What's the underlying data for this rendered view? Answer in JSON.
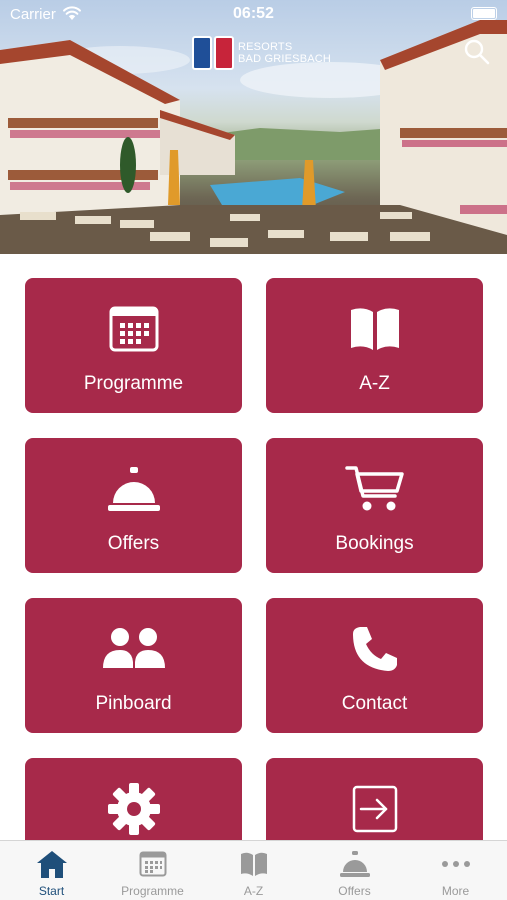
{
  "status_bar": {
    "carrier": "Carrier",
    "time": "06:52"
  },
  "header": {
    "brand_line1": "RESORTS",
    "brand_line2": "BAD GRIESBACH",
    "logo_colors": [
      "#1f4f98",
      "#c7243a"
    ]
  },
  "tiles": [
    {
      "label": "Programme",
      "icon": "calendar-icon"
    },
    {
      "label": "A-Z",
      "icon": "book-icon"
    },
    {
      "label": "Offers",
      "icon": "service-bell-icon"
    },
    {
      "label": "Bookings",
      "icon": "shopping-cart-icon"
    },
    {
      "label": "Pinboard",
      "icon": "users-icon"
    },
    {
      "label": "Contact",
      "icon": "phone-icon"
    },
    {
      "label": "",
      "icon": "gear-icon"
    },
    {
      "label": "",
      "icon": "sign-in-icon"
    }
  ],
  "tabbar": {
    "items": [
      {
        "label": "Start",
        "icon": "home-icon",
        "active": true
      },
      {
        "label": "Programme",
        "icon": "calendar-icon",
        "active": false
      },
      {
        "label": "A-Z",
        "icon": "book-icon",
        "active": false
      },
      {
        "label": "Offers",
        "icon": "service-bell-icon",
        "active": false
      },
      {
        "label": "More",
        "icon": "more-dots-icon",
        "active": false
      }
    ]
  },
  "colors": {
    "tile_background": "#a7294a",
    "active_tab": "#1f4f7a",
    "inactive_tab": "#9a9a9a"
  }
}
